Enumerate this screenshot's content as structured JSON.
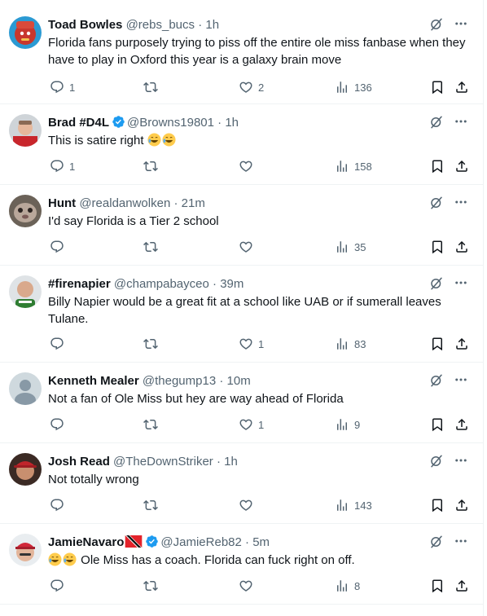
{
  "tweets": [
    {
      "name": "Toad Bowles",
      "handle": "@rebs_bucs",
      "dot": "·",
      "time": "1h",
      "verified": false,
      "flag": false,
      "text": "Florida fans purposely trying to piss off the entire ole miss fanbase when they have to play in Oxford this year is a galaxy brain move",
      "replies": "1",
      "retweets": "",
      "likes": "2",
      "views": "136"
    },
    {
      "name": "Brad #D4L",
      "handle": "@Browns19801",
      "dot": "·",
      "time": "1h",
      "verified": true,
      "flag": false,
      "text": "This is satire right",
      "emoji_suffix": 2,
      "replies": "1",
      "retweets": "",
      "likes": "",
      "views": "158"
    },
    {
      "name": "Hunt",
      "handle": "@realdanwolken",
      "dot": "·",
      "time": "21m",
      "verified": false,
      "flag": false,
      "text": "I'd say Florida is a Tier 2 school",
      "replies": "",
      "retweets": "",
      "likes": "",
      "views": "35"
    },
    {
      "name": "#firenapier",
      "handle": "@champabayceo",
      "dot": "·",
      "time": "39m",
      "verified": false,
      "flag": false,
      "text": "Billy Napier would be a great fit at a school like UAB or if sumerall leaves Tulane.",
      "replies": "",
      "retweets": "",
      "likes": "1",
      "views": "83"
    },
    {
      "name": "Kenneth Mealer",
      "handle": "@thegump13",
      "dot": "·",
      "time": "10m",
      "verified": false,
      "flag": false,
      "text": "Not a fan of Ole Miss but hey are way ahead of Florida",
      "replies": "",
      "retweets": "",
      "likes": "1",
      "views": "9"
    },
    {
      "name": "Josh Read",
      "handle": "@TheDownStriker",
      "dot": "·",
      "time": "1h",
      "verified": false,
      "flag": false,
      "text": "Not totally wrong",
      "replies": "",
      "retweets": "",
      "likes": "",
      "views": "143"
    },
    {
      "name": "JamieNavaro",
      "handle": "@JamieReb82",
      "dot": "·",
      "time": "5m",
      "verified": true,
      "flag": true,
      "text": " Ole Miss has a coach. Florida can fuck right on off.",
      "emoji_prefix": 2,
      "replies": "",
      "retweets": "",
      "likes": "",
      "views": "8"
    }
  ],
  "icons": {
    "reply": "reply-icon",
    "retweet": "retweet-icon",
    "like": "heart-icon",
    "views": "views-icon",
    "bookmark": "bookmark-icon",
    "share": "share-icon",
    "grok": "grok-icon",
    "more": "more-icon",
    "verified": "verified-badge-icon"
  },
  "colors": {
    "text": "#0f1419",
    "secondary": "#536471",
    "verified": "#1d9bf0",
    "divider": "#eff3f4"
  }
}
